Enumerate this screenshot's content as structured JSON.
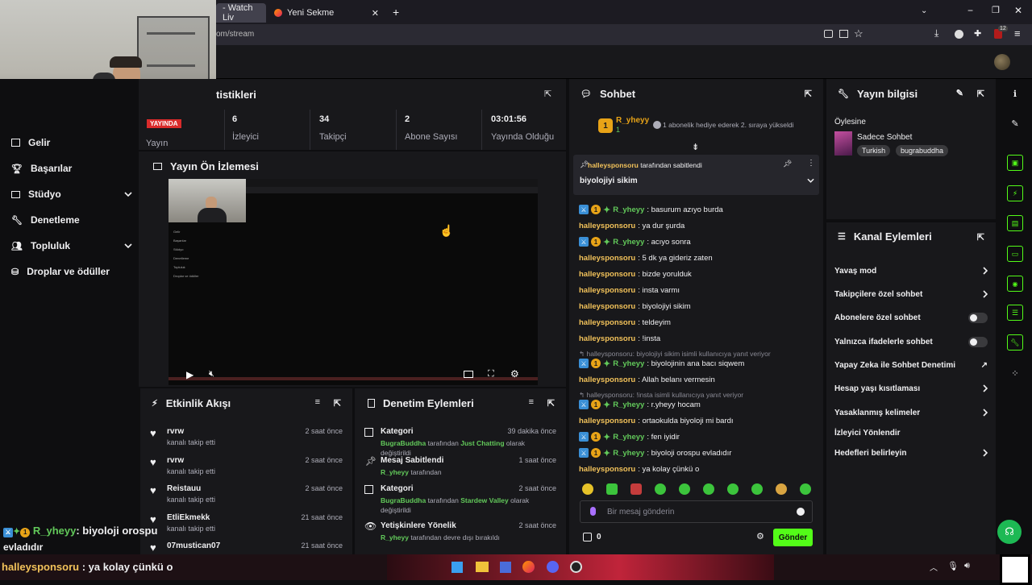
{
  "browser": {
    "tabs": [
      {
        "label": "- Watch Liv"
      },
      {
        "label": "Yeni Sekme"
      }
    ],
    "url_tail": "om/stream",
    "badge_count": "12"
  },
  "sidebar": {
    "items": [
      {
        "label": "Gelir"
      },
      {
        "label": "Başarılar"
      },
      {
        "label": "Stüdyo"
      },
      {
        "label": "Denetleme"
      },
      {
        "label": "Topluluk"
      },
      {
        "label": "Droplar ve ödüller"
      }
    ]
  },
  "stats_panel": {
    "title_fragment": "tistikleri",
    "live_badge": "YAYINDA",
    "stats": [
      {
        "value": "",
        "label": "Yayın"
      },
      {
        "value": "6",
        "label": "İzleyici"
      },
      {
        "value": "34",
        "label": "Takipçi"
      },
      {
        "value": "2",
        "label": "Abone Sayısı"
      },
      {
        "value": "03:01:56",
        "label": "Yayında Olduğu"
      }
    ]
  },
  "preview_panel": {
    "title": "Yayın Ön İzlemesi",
    "mini_sidebar": [
      "Gelir",
      "Başarılar",
      "Stüdyo",
      "Denetleme",
      "Topluluk",
      "Droplar ve ödüller"
    ]
  },
  "activity_feed": {
    "title": "Etkinlik Akışı",
    "items": [
      {
        "name": "rvrw",
        "sub": "kanalı takip etti",
        "time": "2 saat önce"
      },
      {
        "name": "rvrw",
        "sub": "kanalı takip etti",
        "time": "2 saat önce"
      },
      {
        "name": "Reistauu",
        "sub": "kanalı takip etti",
        "time": "2 saat önce"
      },
      {
        "name": "EtliEkmekk",
        "sub": "kanalı takip etti",
        "time": "21 saat önce"
      },
      {
        "name": "07mustican07",
        "sub": "",
        "time": "21 saat önce"
      }
    ]
  },
  "moderation": {
    "title": "Denetim Eylemleri",
    "items": [
      {
        "name": "Kategori",
        "time": "39 dakika önce",
        "user": "BugraBuddha",
        "mid": " tarafından ",
        "target": "Just Chatting",
        "end": " olarak değiştirildi"
      },
      {
        "name": "Mesaj Sabitlendi",
        "time": "1 saat önce",
        "user": "R_yheyy",
        "mid": " tarafından",
        "target": "",
        "end": ""
      },
      {
        "name": "Kategori",
        "time": "2 saat önce",
        "user": "BugraBuddha",
        "mid": " tarafından ",
        "target": "Stardew Valley",
        "end": " olarak değiştirildi"
      },
      {
        "name": "Yetişkinlere Yönelik",
        "time": "2 saat önce",
        "user": "R_yheyy",
        "mid": " tarafından devre dışı bırakıldı",
        "target": "",
        "end": ""
      }
    ]
  },
  "chat": {
    "title": "Sohbet",
    "top_user": "R_yheyy",
    "top_user_count": "1",
    "top_rank": "1",
    "gift_notice": "1 abonelik hediye ederek 2. sıraya yükseldi",
    "pinned_by": "halleysponsoru",
    "pinned_suffix": "tarafından sabitlendi",
    "pinned_text": "biyolojiyi sikim",
    "messages": [
      {
        "user": "R_yheyy",
        "type": "r",
        "text": ": basurum azıyo burda"
      },
      {
        "user": "halleysponsoru",
        "type": "h",
        "text": ": ya dur şurda"
      },
      {
        "user": "R_yheyy",
        "type": "r",
        "text": ": acıyo sonra"
      },
      {
        "user": "halleysponsoru",
        "type": "h",
        "text": ": 5 dk ya gideriz zaten"
      },
      {
        "user": "halleysponsoru",
        "type": "h",
        "text": ": bizde yorulduk"
      },
      {
        "user": "halleysponsoru",
        "type": "h",
        "text": ": insta varmı"
      },
      {
        "user": "halleysponsoru",
        "type": "h",
        "text": ": biyolojiyi sikim"
      },
      {
        "user": "halleysponsoru",
        "type": "h",
        "text": ": teldeyim"
      },
      {
        "user": "halleysponsoru",
        "type": "h",
        "text": ": !insta"
      },
      {
        "reply": "halleysponsoru: biyolojiyi sikim isimli kullanıcıya yanıt veriyor"
      },
      {
        "user": "R_yheyy",
        "type": "r",
        "text": ": biyolojinin ana bacı siqwem"
      },
      {
        "user": "halleysponsoru",
        "type": "h",
        "text": ": Allah belanı vermesin"
      },
      {
        "reply": "halleysponsoru: !insta isimli kullanıcıya yanıt veriyor"
      },
      {
        "user": "R_yheyy",
        "type": "r",
        "text": ": r.yheyy hocam"
      },
      {
        "user": "halleysponsoru",
        "type": "h",
        "text": ": ortaokulda biyoloji mi bardı"
      },
      {
        "user": "R_yheyy",
        "type": "r",
        "text": ": fen iyidir"
      },
      {
        "user": "R_yheyy",
        "type": "r",
        "text": ": biyoloji orospu evladıdır"
      },
      {
        "user": "halleysponsoru",
        "type": "h",
        "text": ": ya kolay çünkü o"
      }
    ],
    "input_placeholder": "Bir mesaj gönderin",
    "points": "0",
    "send_label": "Gönder"
  },
  "stream_info": {
    "title": "Yayın bilgisi",
    "stream_title": "Öylesine",
    "category": "Sadece Sohbet",
    "tags": [
      "Turkish",
      "bugrabuddha"
    ]
  },
  "channel_actions": {
    "title": "Kanal Eylemleri",
    "items": [
      {
        "label": "Yavaş mod",
        "control": "chevron"
      },
      {
        "label": "Takipçilere özel sohbet",
        "control": "chevron"
      },
      {
        "label": "Abonelere özel sohbet",
        "control": "toggle"
      },
      {
        "label": "Yalnızca ifadelerle sohbet",
        "control": "toggle"
      },
      {
        "label": "Yapay Zeka ile Sohbet Denetimi",
        "control": "external"
      },
      {
        "label": "Hesap yaşı kısıtlaması",
        "control": "chevron"
      },
      {
        "label": "Yasaklanmış kelimeler",
        "control": "chevron"
      },
      {
        "label": "İzleyici Yönlendir",
        "control": "none"
      },
      {
        "label": "Hedefleri belirleyin",
        "control": "chevron"
      }
    ]
  },
  "overlay": {
    "line1_user": "R_yheyy",
    "line1_text": ": biyoloji orospu",
    "line1_cont": "evladıdır",
    "line2_user": "halleysponsoru",
    "line2_text": " : ya kolay çünkü o"
  },
  "colors": {
    "accent_green": "#53fc18",
    "user_yellow": "#f2c25a",
    "user_green": "#62c95a",
    "mod_blue": "#3a8fd6",
    "panel": "#18181b",
    "background": "#0e0e10"
  }
}
